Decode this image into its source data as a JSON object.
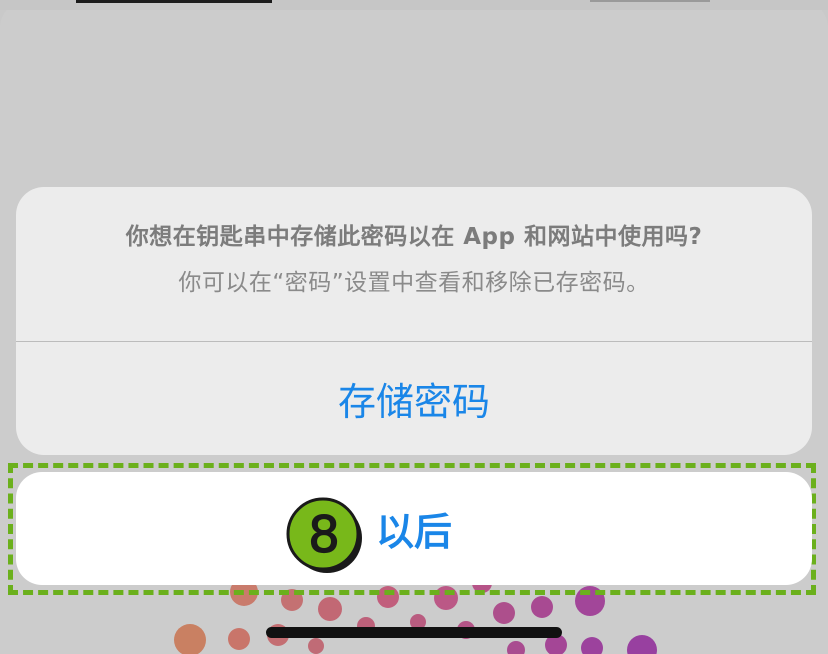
{
  "alert": {
    "title": "你想在钥匙串中存储此密码以在 App 和网站中使用吗?",
    "message": "你可以在“密码”设置中查看和移除已存密码。",
    "primary_action": "存储密码",
    "cancel_action": "以后"
  },
  "annotation": {
    "step_number": "8"
  },
  "colors": {
    "accent": "#1a86e8",
    "highlight": "#6bb01c",
    "badge": "#78b81a"
  }
}
